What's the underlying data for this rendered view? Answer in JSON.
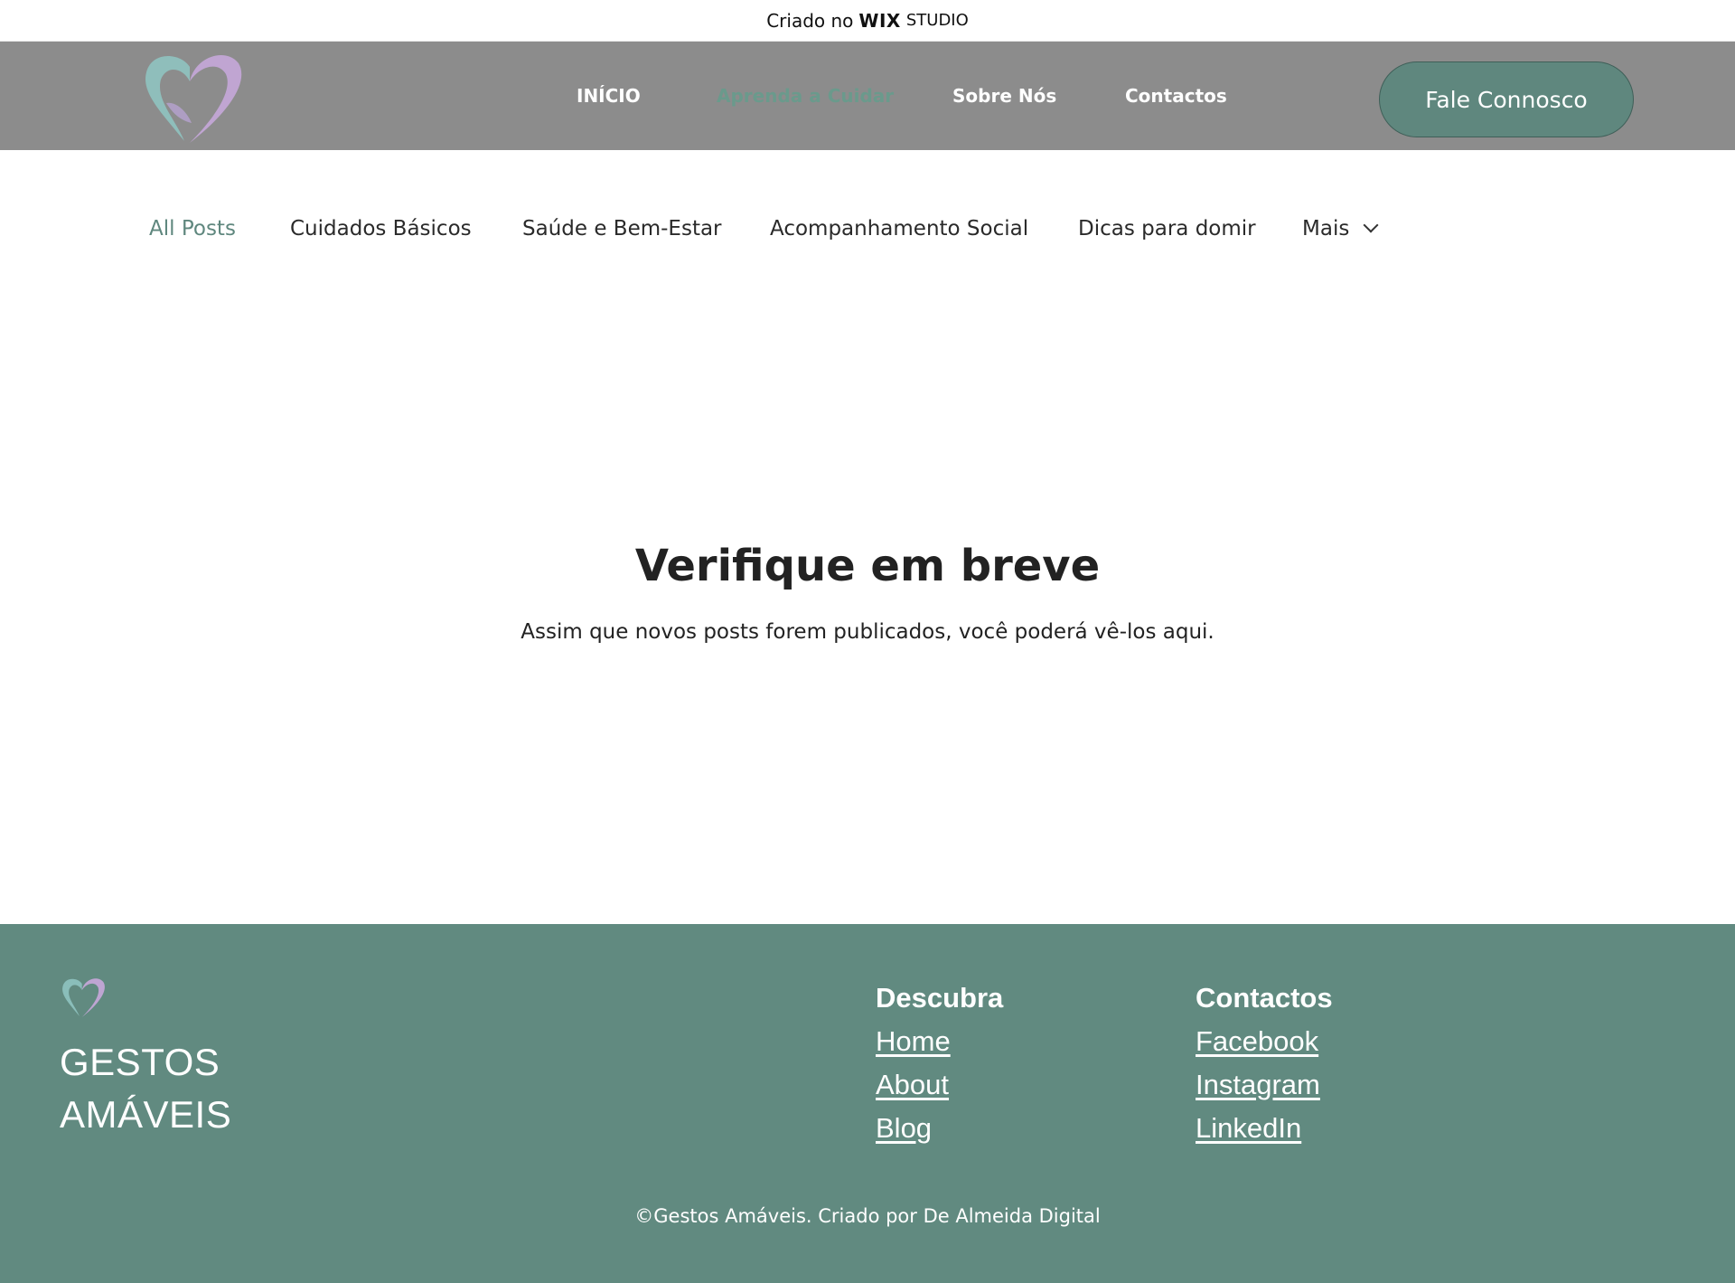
{
  "wix_banner": {
    "prefix": "Criado no",
    "brand": "WIX",
    "product": "STUDIO"
  },
  "header": {
    "logo_icon": "heart-hands-icon",
    "nav": [
      {
        "label": "INÍCIO",
        "active": false
      },
      {
        "label": "Aprenda a Cuidar",
        "active": true
      },
      {
        "label": "Sobre Nós",
        "active": false
      },
      {
        "label": "Contactos",
        "active": false
      }
    ],
    "cta_label": "Fale Connosco"
  },
  "categories": {
    "items": [
      {
        "label": "All Posts",
        "active": true
      },
      {
        "label": "Cuidados Básicos",
        "active": false
      },
      {
        "label": "Saúde e Bem-Estar",
        "active": false
      },
      {
        "label": "Acompanhamento Social",
        "active": false
      },
      {
        "label": "Dicas para domir",
        "active": false
      }
    ],
    "more_label": "Mais",
    "more_icon": "chevron-down-icon"
  },
  "empty_state": {
    "title": "Verifique em breve",
    "message": "Assim que novos posts forem publicados, você poderá vê-los aqui."
  },
  "footer": {
    "brand_line1": "GESTOS",
    "brand_line2": "AMÁVEIS",
    "columns": [
      {
        "title": "Descubra",
        "links": [
          "Home",
          "About",
          "Blog"
        ]
      },
      {
        "title": "Contactos",
        "links": [
          "Facebook",
          "Instagram",
          "LinkedIn"
        ]
      }
    ],
    "copyright": "©Gestos Amáveis. Criado por De Almeida Digital"
  },
  "colors": {
    "header_bg": "#8c8c8c",
    "accent": "#5f877e",
    "footer_bg": "#618a80",
    "logo_teal": "#8fc3c0",
    "logo_lilac": "#c3a6d6"
  }
}
